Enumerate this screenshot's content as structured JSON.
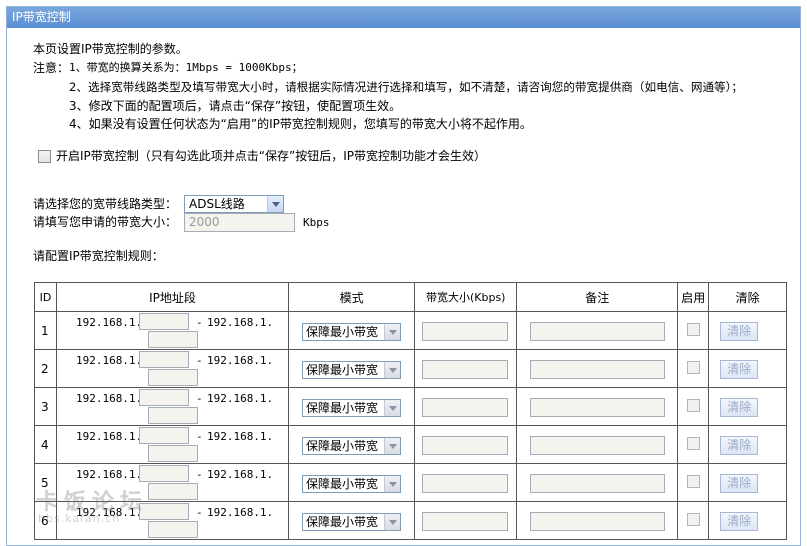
{
  "window": {
    "title": "IP带宽控制"
  },
  "intro": {
    "line1": "本页设置IP带宽控制的参数。",
    "note_label": "注意：",
    "notes": [
      "1、带宽的换算关系为：1Mbps = 1000Kbps；",
      "2、选择宽带线路类型及填写带宽大小时，请根据实际情况进行选择和填写，如不清楚，请咨询您的带宽提供商（如电信、网通等）；",
      "3、修改下面的配置项后，请点击“保存”按钮，使配置项生效。",
      "4、如果没有设置任何状态为“启用”的IP带宽控制规则，您填写的带宽大小将不起作用。"
    ]
  },
  "enable": {
    "label": "开启IP带宽控制（只有勾选此项并点击“保存”按钮后，IP带宽控制功能才会生效）"
  },
  "line_type": {
    "label": "请选择您的宽带线路类型：",
    "value": "ADSL线路"
  },
  "bandwidth": {
    "label": "请填写您申请的带宽大小：",
    "value": "2000",
    "unit": "Kbps"
  },
  "rules_title": "请配置IP带宽控制规则：",
  "table": {
    "headers": {
      "id": "ID",
      "ip": "IP地址段",
      "mode": "模式",
      "bw": "带宽大小(Kbps)",
      "note": "备注",
      "enable": "启用",
      "clear": "清除"
    },
    "ip_prefix": "192.168.1.",
    "ip_sep": "-",
    "rows": [
      {
        "id": "1",
        "mode": "保障最小带宽",
        "clear": "清除"
      },
      {
        "id": "2",
        "mode": "保障最小带宽",
        "clear": "清除"
      },
      {
        "id": "3",
        "mode": "保障最小带宽",
        "clear": "清除"
      },
      {
        "id": "4",
        "mode": "保障最小带宽",
        "clear": "清除"
      },
      {
        "id": "5",
        "mode": "保障最小带宽",
        "clear": "清除"
      },
      {
        "id": "6",
        "mode": "保障最小带宽",
        "clear": "清除"
      }
    ]
  },
  "watermark": {
    "text": "卡饭论坛",
    "sub": "bbs.kafan.cn"
  }
}
